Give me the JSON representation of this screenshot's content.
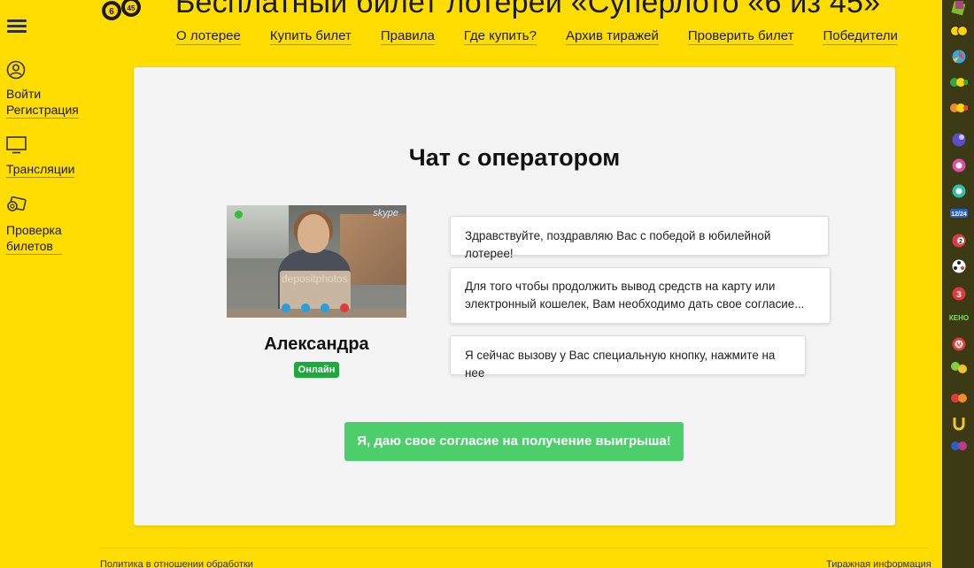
{
  "header": {
    "title": "Бесплатный билет лотерей «Суперлото «6 из 45»",
    "logo": "lottery-balls-logo",
    "nav": [
      "О лотерее",
      "Купить билет",
      "Правила",
      "Где купить?",
      "Архив тиражей",
      "Проверить билет",
      "Победители"
    ]
  },
  "sidebar": {
    "menu_icon": "hamburger-icon",
    "login": "Войти",
    "register": "Регистрация",
    "broadcasts": "Трансляции",
    "ticket_check_line1": "Проверка",
    "ticket_check_line2": "билетов"
  },
  "chat": {
    "title": "Чат с оператором",
    "operator_name": "Александра",
    "status": "Онлайн",
    "video_brand": "skype",
    "video_watermark": "depositphotos",
    "messages": [
      "Здравствуйте, поздравляю Вас с победой в юбилейной лотерее!",
      "Для того чтобы продолжить вывод средств на карту или электронный кошелек, Вам необходимо дать свое согласие...",
      "Я сейчас вызову у Вас специальную кнопку, нажмите на нее"
    ],
    "cta": "Я, даю свое согласие на получение выигрыша!"
  },
  "footer": {
    "left": "Политика в отношении обработки",
    "right": "Тиражная информация"
  },
  "right_bar": {
    "icons": [
      "lottery-icon-1",
      "lottery-icon-2",
      "lottery-icon-3",
      "lottery-icon-4",
      "lottery-icon-5",
      "lottery-icon-6",
      "lottery-icon-7",
      "lottery-icon-8",
      "lottery-icon-9",
      "lottery-icon-10",
      "lottery-icon-11",
      "lottery-icon-12",
      "lottery-icon-13",
      "lottery-icon-14",
      "lottery-icon-15",
      "lottery-icon-16",
      "lottery-icon-17",
      "lottery-icon-18"
    ],
    "keno_label": "КЕНО"
  },
  "colors": {
    "background": "#ffdd00",
    "cta": "#4cce6a",
    "badge": "#1fa83d",
    "right_bar": "#3b3a15"
  }
}
